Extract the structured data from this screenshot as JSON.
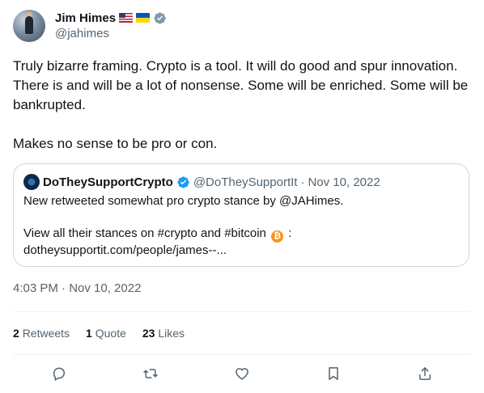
{
  "author": {
    "name": "Jim Himes",
    "handle": "@jahimes",
    "flags": [
      "us-flag-icon",
      "ukraine-flag-icon"
    ],
    "verified_color": "#829aab"
  },
  "tweet": {
    "paragraphs": [
      "Truly bizarre framing. Crypto is a tool. It will do good and spur innovation. There is and will be a lot of nonsense. Some will be enriched. Some will be bankrupted.",
      "Makes no sense to be pro or con."
    ],
    "timestamp": "4:03 PM · Nov 10, 2022"
  },
  "quote": {
    "name": "DoTheySupportCrypto",
    "handle": "@DoTheySupportIt",
    "separator": "·",
    "date": "Nov 10, 2022",
    "line1": "New retweeted somewhat pro crypto stance by @JAHimes.",
    "line2_prefix": "View all their stances on #crypto and #bitcoin",
    "line2_suffix": ":",
    "bitcoin_glyph": "₿",
    "line3": "dotheysupportit.com/people/james--...",
    "verified_color": "#1d9bf0"
  },
  "stats": {
    "retweets": {
      "count": "2",
      "label": "Retweets"
    },
    "quotes": {
      "count": "1",
      "label": "Quote"
    },
    "likes": {
      "count": "23",
      "label": "Likes"
    }
  },
  "actions": [
    "reply-icon",
    "retweet-icon",
    "like-icon",
    "bookmark-icon",
    "share-icon"
  ],
  "colors": {
    "text": "#0f1419",
    "secondary": "#536471",
    "border": "#cfd9de",
    "divider": "#eff3f4",
    "bitcoin": "#f7931a"
  }
}
